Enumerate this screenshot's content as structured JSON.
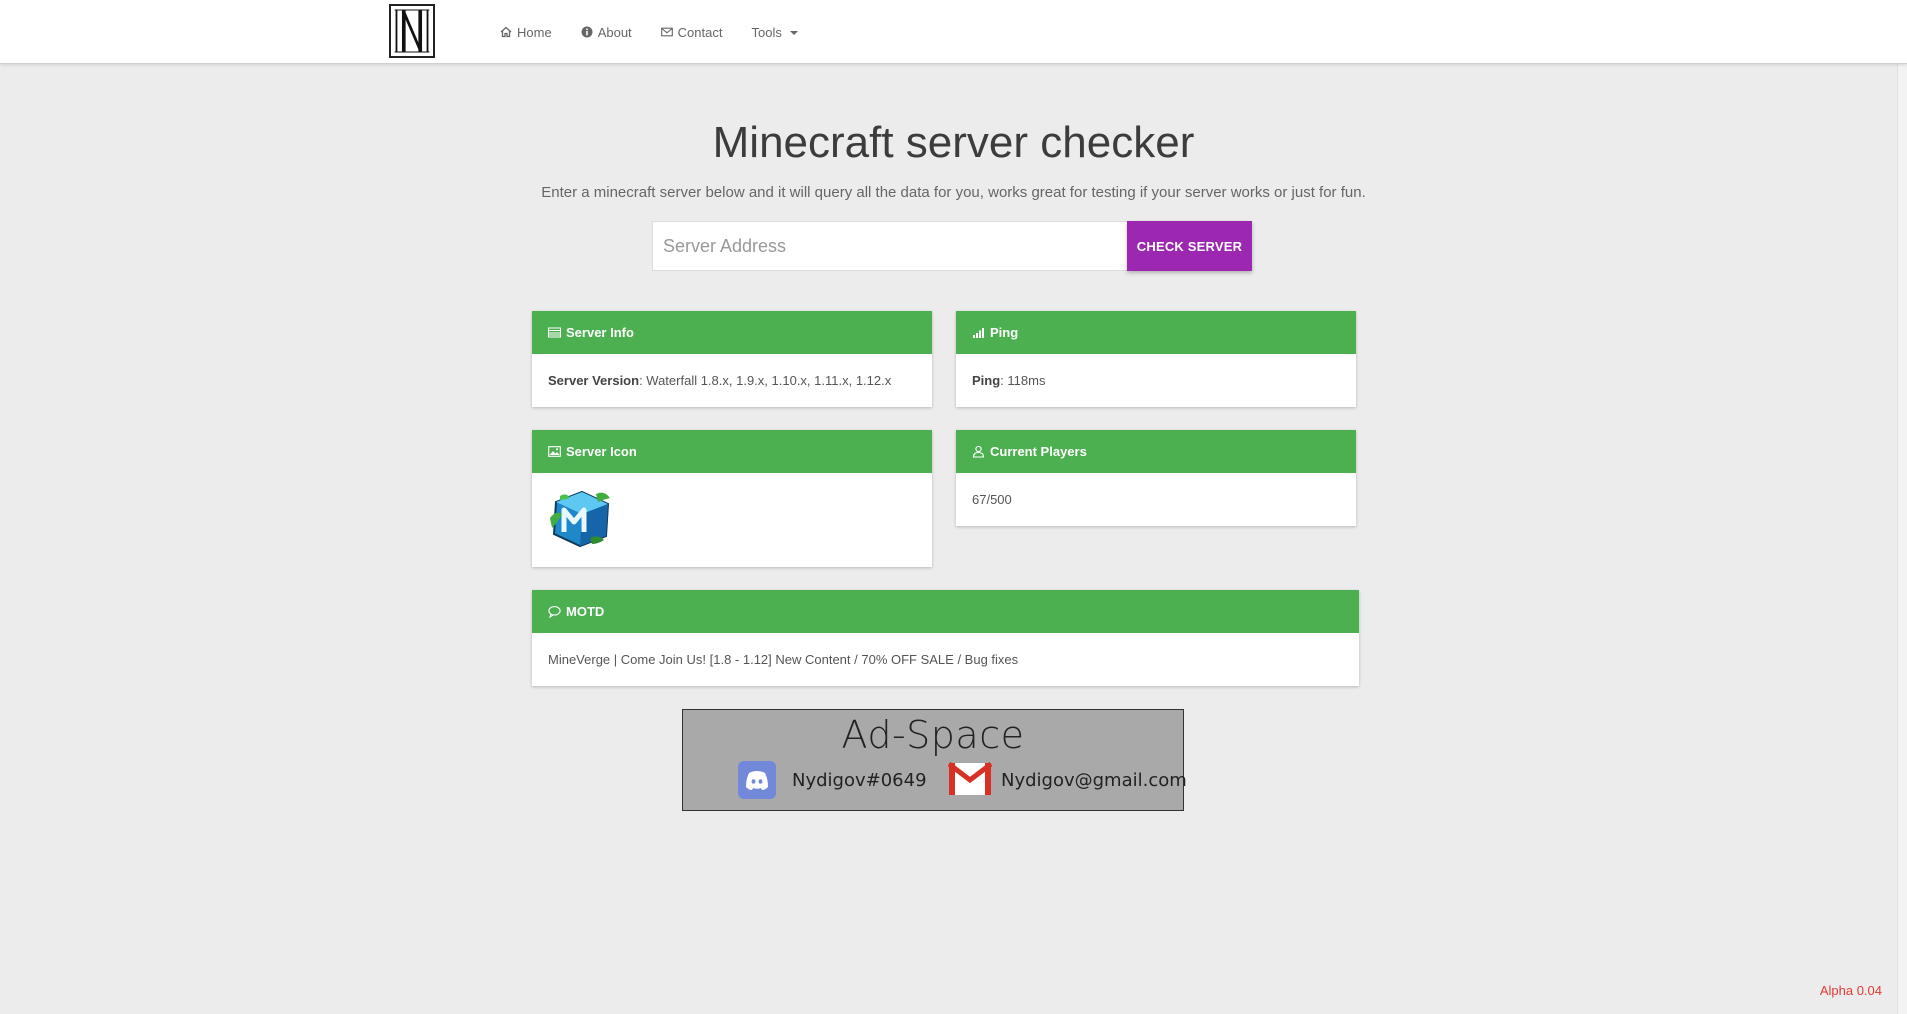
{
  "nav": {
    "logo_letter": "N",
    "items": [
      {
        "label": "Home",
        "icon": "home-icon"
      },
      {
        "label": "About",
        "icon": "info-icon"
      },
      {
        "label": "Contact",
        "icon": "envelope-icon"
      }
    ],
    "tools_label": "Tools"
  },
  "hero": {
    "title": "Minecraft server checker",
    "subtitle": "Enter a minecraft server below and it will query all the data for you, works great for testing if your server works or just for fun."
  },
  "search": {
    "placeholder": "Server Address",
    "value": "",
    "button_label": "CHECK SERVER"
  },
  "panels": {
    "server_info": {
      "title": "Server Info",
      "key": "Server Version",
      "value": ": Waterfall 1.8.x, 1.9.x, 1.10.x, 1.11.x, 1.12.x"
    },
    "ping": {
      "title": "Ping",
      "key": "Ping",
      "value": ": 118ms"
    },
    "server_icon": {
      "title": "Server Icon"
    },
    "players": {
      "title": "Current Players",
      "value": "67/500"
    },
    "motd": {
      "title": "MOTD",
      "value": "MineVerge | Come Join Us! [1.8 - 1.12] New Content / 70% OFF SALE / Bug fixes"
    }
  },
  "ad": {
    "title": "Ad-Space",
    "discord": "Nydigov#0649",
    "email": "Nydigov@gmail.com"
  },
  "footer": {
    "version": "Alpha 0.04"
  },
  "colors": {
    "panel_header": "#4caf50",
    "button": "#9c27b0",
    "version": "#e53935",
    "background": "#ececec"
  }
}
